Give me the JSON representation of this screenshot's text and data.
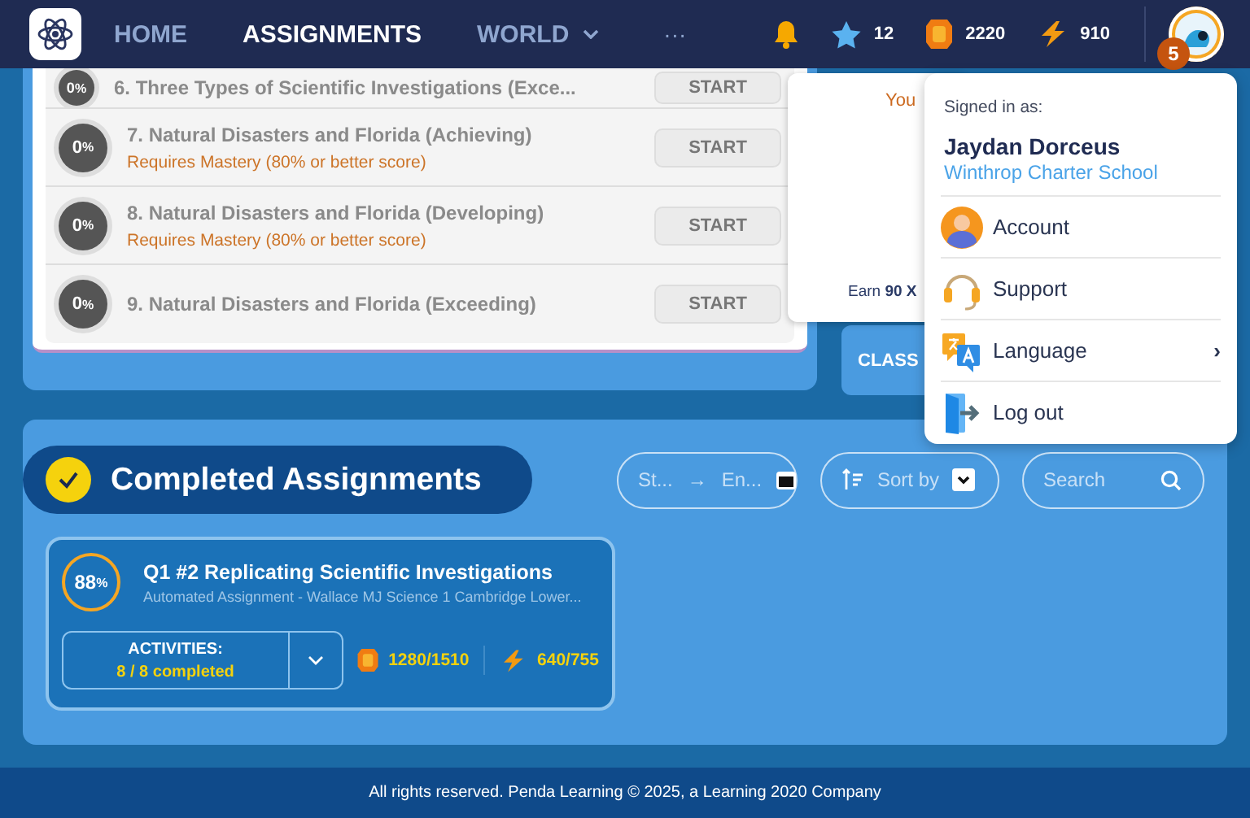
{
  "nav": {
    "tabs": [
      {
        "label": "HOME",
        "selected": false,
        "dropdown": false
      },
      {
        "label": "ASSIGNMENTS",
        "selected": true,
        "dropdown": false
      },
      {
        "label": "WORLD",
        "selected": false,
        "dropdown": true
      }
    ],
    "more": "···",
    "stats": [
      {
        "kind": "star",
        "value": "12"
      },
      {
        "kind": "coin",
        "value": "2220"
      },
      {
        "kind": "xp",
        "value": "910"
      }
    ],
    "avatar_badge": "5"
  },
  "assignments": [
    {
      "score": "0",
      "unit": "%",
      "title": "6. Three Types of Scientific Investigations (Exce...",
      "action": "START"
    },
    {
      "score": "0",
      "unit": "%",
      "title": "7. Natural Disasters and Florida (Achieving)",
      "note": "Requires Mastery (80% or better score)",
      "action": "START"
    },
    {
      "score": "0",
      "unit": "%",
      "title": "8. Natural Disasters and Florida (Developing)",
      "note": "Requires Mastery (80% or better score)",
      "action": "START"
    },
    {
      "score": "0",
      "unit": "%",
      "title": "9. Natural Disasters and Florida (Exceeding)",
      "action": "START"
    }
  ],
  "popover": {
    "line_1": "You",
    "line_2": "Earn **90 X**"
  },
  "class_button": "CLASS",
  "user_menu": {
    "signed_in_label": "Signed in as:",
    "name": "Jaydan Dorceus",
    "school": "Winthrop Charter School",
    "items": [
      {
        "kind": "account",
        "label": "Account"
      },
      {
        "kind": "support",
        "label": "Support"
      },
      {
        "kind": "language",
        "label": "Language",
        "submenu": "›"
      },
      {
        "kind": "logout",
        "label": "Log out"
      }
    ]
  },
  "completed": {
    "title": "Completed Assignments",
    "date_range": {
      "start": "St...",
      "arrow": "→",
      "end": "En..."
    },
    "sort": {
      "label": "Sort by"
    },
    "search": {
      "placeholder": "Search"
    },
    "cards": [
      {
        "score": "88",
        "unit": "%",
        "title": "Q1 #2 Replicating Scientific Investigations",
        "subtitle": "Automated Assignment - Wallace MJ Science 1 Cambridge Lower...",
        "activities_label": "ACTIVITIES:",
        "activities_value": "8 / 8 completed",
        "coins": "1280/1510",
        "xp": "640/755"
      }
    ]
  },
  "footer": "All rights reserved. Penda Learning © 2025, a Learning 2020 Company"
}
